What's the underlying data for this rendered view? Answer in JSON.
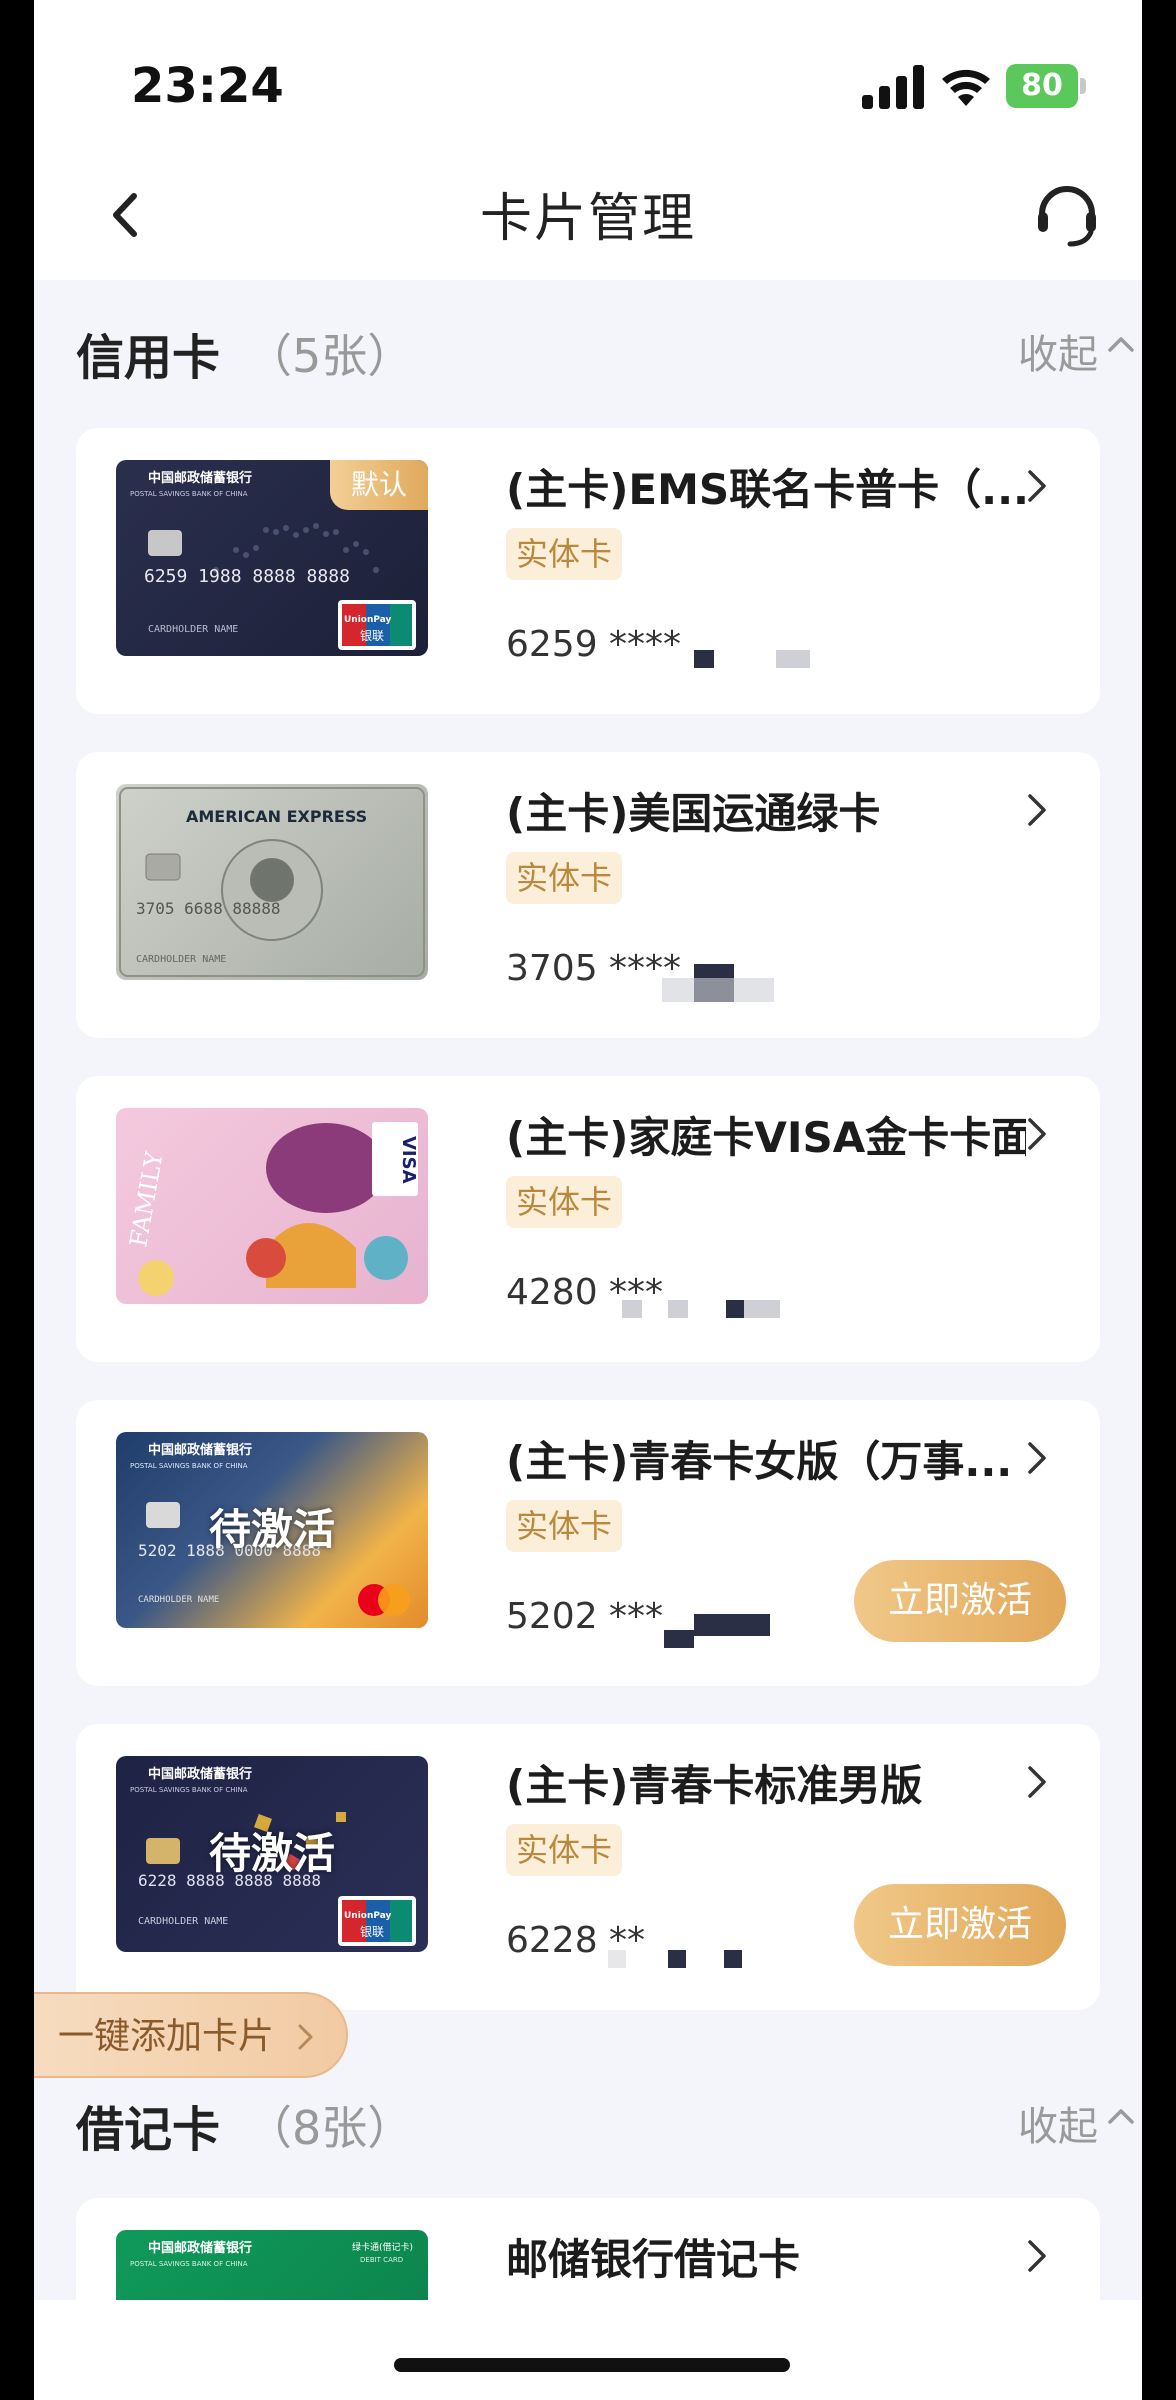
{
  "status_bar": {
    "time": "23:24",
    "battery": "80"
  },
  "nav": {
    "title": "卡片管理"
  },
  "credit": {
    "title": "信用卡",
    "count": "（5张）",
    "collapse_label": "收起",
    "cards": [
      {
        "name": "(主卡)EMS联名卡普卡（...",
        "tag": "实体卡",
        "number": "6259 ****",
        "default_badge": "默认",
        "pending": "",
        "action": ""
      },
      {
        "name": "(主卡)美国运通绿卡",
        "tag": "实体卡",
        "number": "3705 ****",
        "default_badge": "",
        "pending": "",
        "action": ""
      },
      {
        "name": "(主卡)家庭卡VISA金卡卡面",
        "tag": "实体卡",
        "number": "4280 ***",
        "default_badge": "",
        "pending": "",
        "action": ""
      },
      {
        "name": "(主卡)青春卡女版（万事...",
        "tag": "实体卡",
        "number": "5202 ***",
        "default_badge": "",
        "pending": "待激活",
        "action": "立即激活"
      },
      {
        "name": "(主卡)青春卡标准男版",
        "tag": "实体卡",
        "number": "6228 **",
        "default_badge": "",
        "pending": "待激活",
        "action": "立即激活"
      }
    ]
  },
  "debit": {
    "title": "借记卡",
    "count": "（8张）",
    "collapse_label": "收起",
    "cards": [
      {
        "name": "邮储银行借记卡"
      }
    ]
  },
  "add_button": "一键添加卡片",
  "card_faces": {
    "bank_name": "中国邮政储蓄银行",
    "bank_en": "POSTAL SAVINGS BANK OF CHINA",
    "cardholder": "CARDHOLDER NAME",
    "amex_brand": "AMERICAN EXPRESS",
    "visa_brand": "VISA",
    "family_text": "FAMILY",
    "unionpay": "UnionPay",
    "unionpay_cn": "银联",
    "emboss_1": "6259 1988 8888 8888",
    "emboss_2": "3705 6688 88888",
    "emboss_4": "5202 1888 0000 8888",
    "emboss_5": "6228 8888 8888 8888",
    "debit_label": "绿卡通(借记卡)",
    "debit_en": "DEBIT CARD"
  },
  "colors": {
    "accent": "#e2a85a",
    "tag_bg": "#fbefd9",
    "tag_text": "#b98a3e",
    "page_bg": "#f3f5fa"
  }
}
